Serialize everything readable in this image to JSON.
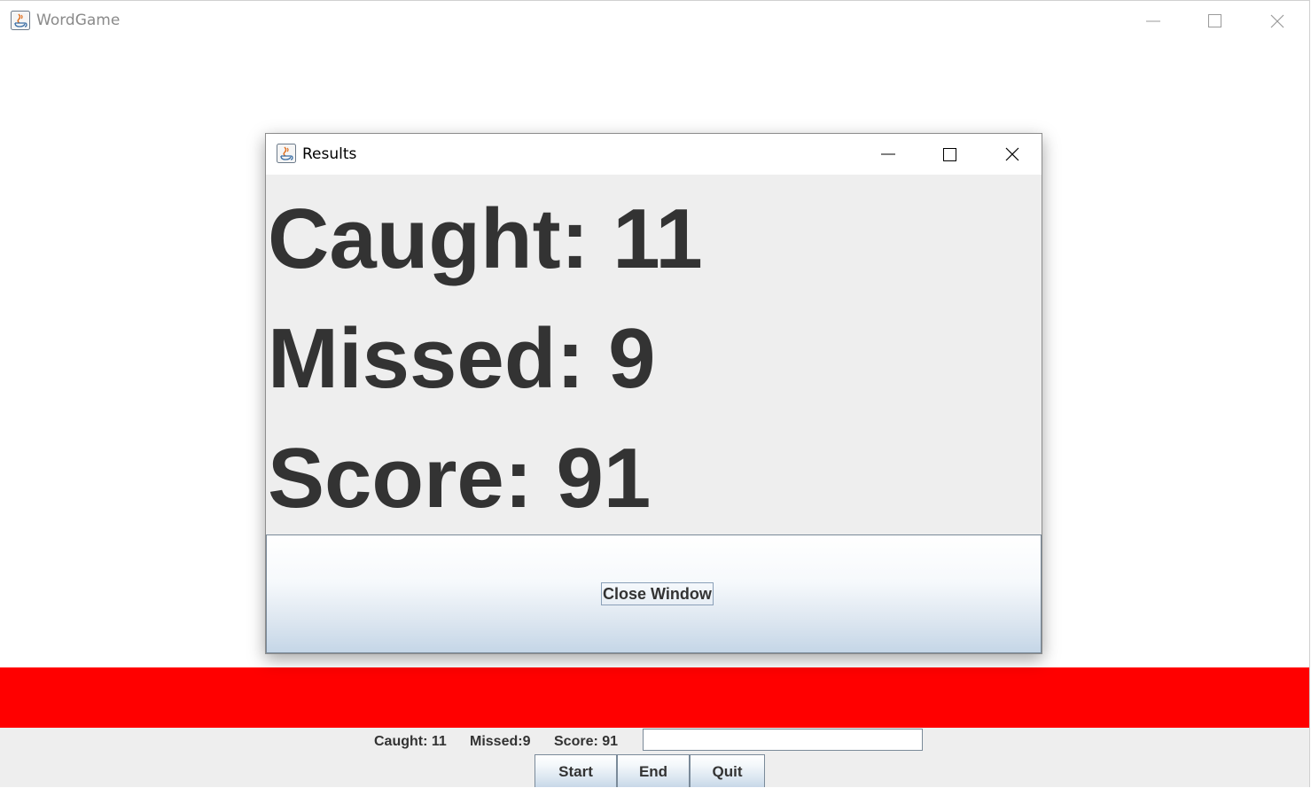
{
  "main_window": {
    "title": "WordGame"
  },
  "dialog": {
    "title": "Results",
    "caught": "Caught: 11",
    "missed": "Missed: 9",
    "score": "Score: 91",
    "close_button": "Close Window"
  },
  "status_bar": {
    "caught": "Caught: 11",
    "missed": "Missed:9",
    "score": "Score: 91",
    "input_value": ""
  },
  "buttons": {
    "start": "Start",
    "end": "End",
    "quit": "Quit"
  },
  "colors": {
    "danger_band": "#ff0000",
    "panel_bg": "#eeeeee",
    "text": "#333333"
  },
  "icons": [
    "java-icon",
    "minimize-icon",
    "maximize-icon",
    "close-icon"
  ]
}
